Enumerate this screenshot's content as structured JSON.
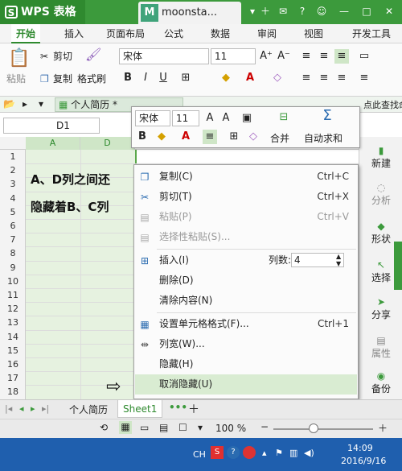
{
  "titlebar": {
    "app_name": "WPS 表格",
    "doc_tab": "moonsta...",
    "doc_letter": "M"
  },
  "menu_tabs": [
    "开始",
    "插入",
    "页面布局",
    "公式",
    "数据",
    "审阅",
    "视图",
    "开发工具"
  ],
  "ribbon": {
    "cut": "剪切",
    "paste": "粘贴",
    "copy": "复制",
    "format_painter": "格式刷",
    "font_name": "宋体",
    "font_size": "11",
    "bold": "B",
    "italic": "I",
    "underline": "U",
    "grow_font": "A⁺",
    "shrink_font": "A⁻"
  },
  "docrow": {
    "file_tab": "个人简历 *",
    "search_hint": "点此查找命令 (Alt+Q)"
  },
  "namebox": {
    "value": "D1"
  },
  "columns": [
    "A",
    "D"
  ],
  "rows": [
    "1",
    "2",
    "3",
    "4",
    "5",
    "6",
    "7",
    "8",
    "9",
    "10",
    "11",
    "12",
    "13",
    "14",
    "15",
    "16",
    "17",
    "18"
  ],
  "cells": {
    "line1": "A、D列之间还",
    "line2": "隐藏着B、C列"
  },
  "mini_toolbar": {
    "font_name": "宋体",
    "font_size": "11",
    "merge": "合并",
    "autosum": "自动求和"
  },
  "context_menu": {
    "copy": {
      "label": "复制(C)",
      "shortcut": "Ctrl+C"
    },
    "cut": {
      "label": "剪切(T)",
      "shortcut": "Ctrl+X"
    },
    "paste": {
      "label": "粘贴(P)",
      "shortcut": "Ctrl+V"
    },
    "paste_special": {
      "label": "选择性粘贴(S)..."
    },
    "insert": {
      "label": "插入(I)",
      "count_label": "列数:",
      "count_value": "4"
    },
    "delete": {
      "label": "删除(D)"
    },
    "clear": {
      "label": "清除内容(N)"
    },
    "format_cells": {
      "label": "设置单元格格式(F)...",
      "shortcut": "Ctrl+1"
    },
    "col_width": {
      "label": "列宽(W)..."
    },
    "hide": {
      "label": "隐藏(H)"
    },
    "unhide": {
      "label": "取消隐藏(U)"
    }
  },
  "right_panel": [
    "新建",
    "分析",
    "形状",
    "选择",
    "分享",
    "属性",
    "备份"
  ],
  "sheet_tabs": [
    "个人简历",
    "Sheet1"
  ],
  "status": {
    "zoom": "100 %"
  },
  "taskbar": {
    "lang": "CH",
    "time": "14:09",
    "date": "2016/9/16"
  }
}
